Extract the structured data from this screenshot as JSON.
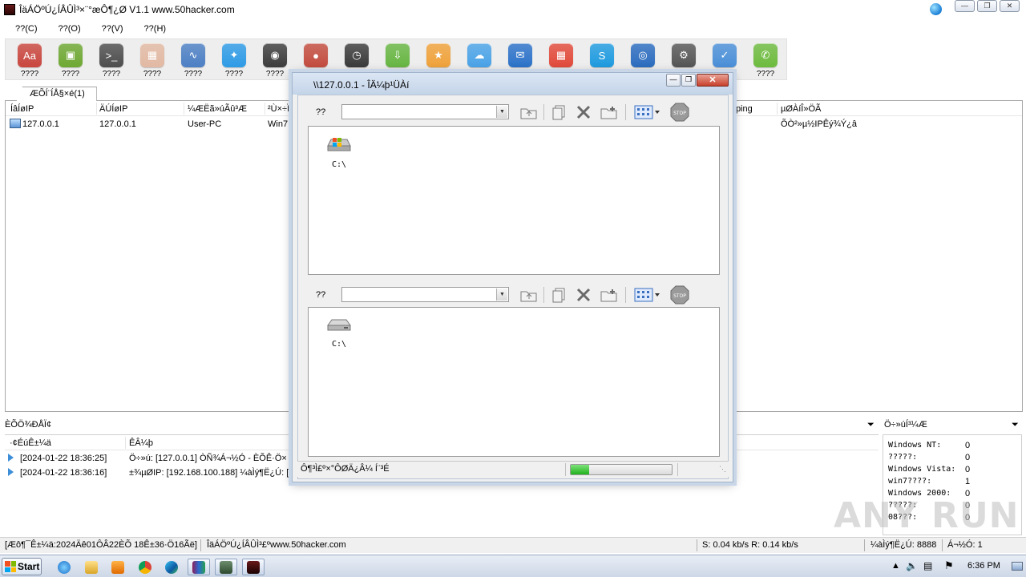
{
  "window": {
    "title": "ÎäÁÖºÚ¿ÍÂÛÌ³×¨°æÔ¶¿Ø V1.1 www.50hacker.com",
    "controls": [
      "minimize",
      "restore",
      "close"
    ]
  },
  "menu": [
    "??(C)",
    "??(O)",
    "??(V)",
    "??(H)"
  ],
  "toolbar": {
    "items": [
      {
        "label": "????",
        "icon": "font-icon",
        "color": "#c9463e"
      },
      {
        "label": "????",
        "icon": "drive-icon",
        "color": "#6ea832"
      },
      {
        "label": "????",
        "icon": "terminal-icon",
        "color": "#4d4d4d"
      },
      {
        "label": "????",
        "icon": "calculator-icon",
        "color": "#e2b9a3"
      },
      {
        "label": "????",
        "icon": "activity-icon",
        "color": "#4c7fc4"
      },
      {
        "label": "????",
        "icon": "appstore-icon",
        "color": "#2e9be6"
      },
      {
        "label": "????",
        "icon": "camera-icon",
        "color": "#3c3c3c"
      },
      {
        "label": "????",
        "icon": "microphone-icon",
        "color": "#c34c3e"
      },
      {
        "label": "????",
        "icon": "clock-icon",
        "color": "#3a3a3a"
      },
      {
        "label": "????",
        "icon": "download-icon",
        "color": "#67b642"
      },
      {
        "label": "????",
        "icon": "star-icon",
        "color": "#f0a23a"
      },
      {
        "label": "????",
        "icon": "cloud-icon",
        "color": "#4aa3e8"
      },
      {
        "label": "????",
        "icon": "chat-icon",
        "color": "#2c72c9"
      },
      {
        "label": "????",
        "icon": "calendar-icon",
        "color": "#e24a3a"
      },
      {
        "label": "????",
        "icon": "skype-icon",
        "color": "#1e9be0"
      },
      {
        "label": "????",
        "icon": "globe-icon",
        "color": "#2b6cbf"
      },
      {
        "label": "????",
        "icon": "gear-icon",
        "color": "#555555"
      },
      {
        "label": "????",
        "icon": "checklist-icon",
        "color": "#4a8fd8"
      },
      {
        "label": "????",
        "icon": "phone-icon",
        "color": "#6dbb3e"
      }
    ]
  },
  "tabs": [
    {
      "label": "ÆÕÍ¨ÍÅ§×é(1)"
    }
  ],
  "hostlist": {
    "columns": [
      "ÍâÍøIP",
      "ÄÚÍøIP",
      "¼ÆËã»úÃû³Æ",
      "²Ù×÷ÏµÍ³",
      "Uping",
      "µØÀíÎ»ÖÃ"
    ],
    "rows": [
      {
        "wan_ip": "127.0.0.1",
        "lan_ip": "127.0.0.1",
        "computer": "User-PC",
        "os": "Win7 SP",
        "location": "ÕÒ²»µ½IPÊý¾Ý¿â"
      }
    ]
  },
  "messages": {
    "pane_title": "ÈÕÖ¾ÐÅÏ¢",
    "columns": [
      "·¢ÉúÊ±¼ä",
      "ÊÂ¼þ"
    ],
    "rows": [
      {
        "time": "[2024-01-22 18:36:25]",
        "event": "Ö÷»ú: [127.0.0.1] ÒÑ¾­Á¬½Ó - ÈÕÊ·Ö×"
      },
      {
        "time": "[2024-01-22 18:36:16]",
        "event": "±¾µØIP: [192.168.100.188] ¼àÌý¶Ë¿Ú: ["
      }
    ]
  },
  "stats": {
    "pane_title": "Ö÷»úÍ³¼Æ",
    "rows": [
      {
        "label": "Windows NT:",
        "value": "0"
      },
      {
        "label": "?????:",
        "value": "0"
      },
      {
        "label": "Windows Vista:",
        "value": "0"
      },
      {
        "label": "win7????:",
        "value": "1"
      },
      {
        "label": "Windows 2000:",
        "value": "0"
      },
      {
        "label": "?????:",
        "value": "0"
      },
      {
        "label": "08???:",
        "value": "0"
      }
    ]
  },
  "statusbar": {
    "left": "[Æô¶¯Ê±¼ä:2024Äê01ÔÂ22ÈÕ 18Ê±36·Ö16Ãë]",
    "site": "ÎäÁÖºÚ¿ÍÂÛÌ³£ºwww.50hacker.com",
    "speed": "S: 0.04 kb/s R: 0.14 kb/s",
    "port": "¼àÌý¶Ë¿Ú: 8888",
    "online": "Á¬½Ó: 1"
  },
  "file_manager": {
    "title": "\\\\127.0.0.1 - ÎÄ¼þ¹ÜÀí",
    "local": {
      "label": "??",
      "path": "",
      "drive": "C:\\"
    },
    "remote": {
      "label": "??",
      "path": "",
      "drive": "C:\\"
    },
    "status": "Ô¶³Ì£º×°ÔØÄ¿Â¼  Í¨³É",
    "progress": 0.18
  },
  "taskbar": {
    "start_label": "Start",
    "clock": "6:36 PM"
  },
  "watermark": "ANY RUN"
}
